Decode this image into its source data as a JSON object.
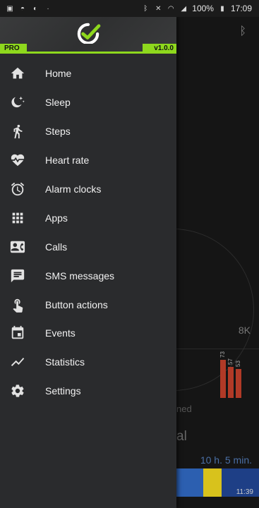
{
  "status_bar": {
    "battery": "100%",
    "time": "17:09",
    "left_icons": [
      "gallery-icon",
      "mibandage-icon",
      "fitness-icon",
      "dot-icon"
    ],
    "right_icons": [
      "bluetooth-icon",
      "mute-icon",
      "wifi-icon",
      "signal-icon",
      "battery-icon"
    ]
  },
  "drawer": {
    "edition": "PRO",
    "version": "v1.0.0",
    "accent_color": "#8ed81d",
    "items": [
      {
        "label": "Home",
        "icon": "home-icon"
      },
      {
        "label": "Sleep",
        "icon": "moon-stars-icon"
      },
      {
        "label": "Steps",
        "icon": "walking-icon"
      },
      {
        "label": "Heart rate",
        "icon": "heart-pulse-icon"
      },
      {
        "label": "Alarm clocks",
        "icon": "alarm-icon"
      },
      {
        "label": "Apps",
        "icon": "apps-grid-icon"
      },
      {
        "label": "Calls",
        "icon": "contact-card-icon"
      },
      {
        "label": "SMS messages",
        "icon": "message-icon"
      },
      {
        "label": "Button actions",
        "icon": "touch-icon"
      },
      {
        "label": "Events",
        "icon": "calendar-icon"
      },
      {
        "label": "Statistics",
        "icon": "trend-icon"
      },
      {
        "label": "Settings",
        "icon": "gear-icon"
      }
    ]
  },
  "background": {
    "steps_goal": "8K",
    "heart_values": [
      "73",
      "57",
      "53"
    ],
    "partial_text_1": "ned",
    "partial_text_2": "al",
    "sleep_duration": "10 h. 5 min.",
    "sleep_time": "11:39",
    "bar_color": "#b13a27",
    "sleep_colors": [
      "#2c5fb0",
      "#d8c21c",
      "#1e3f86"
    ]
  }
}
